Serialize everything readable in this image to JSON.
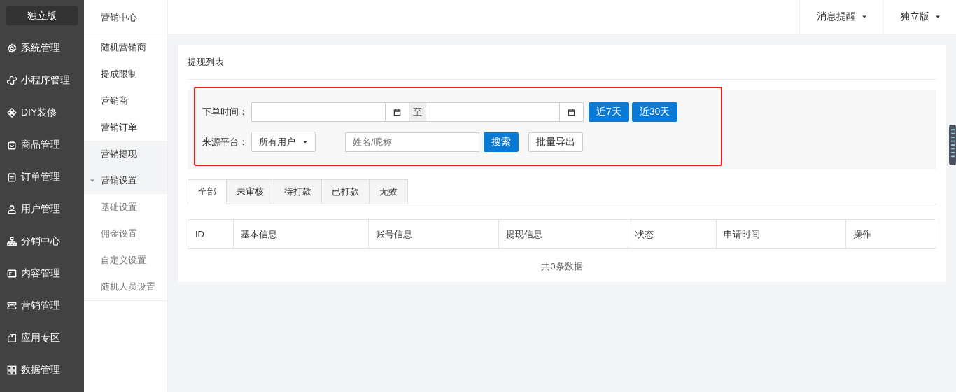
{
  "sidebar": {
    "brand": "独立版",
    "items": [
      {
        "label": "系统管理"
      },
      {
        "label": "小程序管理"
      },
      {
        "label": "DIY装修"
      },
      {
        "label": "商品管理"
      },
      {
        "label": "订单管理"
      },
      {
        "label": "用户管理"
      },
      {
        "label": "分销中心"
      },
      {
        "label": "内容管理"
      },
      {
        "label": "营销管理"
      },
      {
        "label": "应用专区"
      },
      {
        "label": "数据管理"
      }
    ]
  },
  "subnav": {
    "title": "营销中心",
    "items": [
      {
        "label": "随机营销商",
        "selected": false
      },
      {
        "label": "提成限制",
        "selected": false
      },
      {
        "label": "营销商",
        "selected": false
      },
      {
        "label": "营销订单",
        "selected": false
      },
      {
        "label": "营销提现",
        "selected": true
      },
      {
        "label": "营销设置",
        "expanded": true,
        "children": [
          {
            "label": "基础设置",
            "selected": false
          },
          {
            "label": "佣金设置",
            "selected": false
          },
          {
            "label": "自定义设置",
            "selected": false
          },
          {
            "label": "随机人员设置",
            "selected": false
          }
        ]
      }
    ]
  },
  "topbar": {
    "menus": [
      {
        "label": "消息提醒"
      },
      {
        "label": "独立版"
      }
    ]
  },
  "card": {
    "title": "提现列表",
    "filter": {
      "date_label": "下单时间：",
      "date_separator": "至",
      "quick_buttons": [
        "近7天",
        "近30天"
      ],
      "platform_label": "来源平台：",
      "platform_value": "所有用户",
      "search_placeholder": "姓名/昵称",
      "search_button": "搜索",
      "export_button": "批量导出"
    },
    "tabs": [
      {
        "label": "全部",
        "selected": true
      },
      {
        "label": "未审核",
        "selected": false
      },
      {
        "label": "待打款",
        "selected": false
      },
      {
        "label": "已打款",
        "selected": false
      },
      {
        "label": "无效",
        "selected": false
      }
    ],
    "table": {
      "columns": [
        "ID",
        "基本信息",
        "账号信息",
        "提现信息",
        "状态",
        "申请时间",
        "操作"
      ],
      "empty_text": "共0条数据"
    }
  }
}
